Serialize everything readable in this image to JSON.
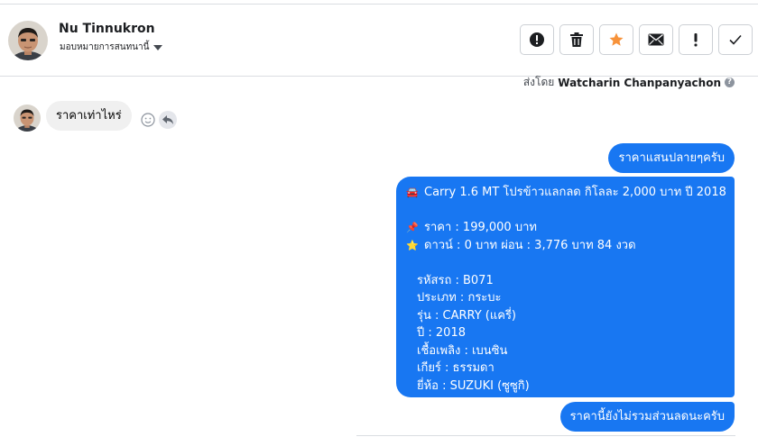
{
  "conversation": {
    "contact_name": "Nu Tinnukron",
    "assign_label": "มอบหมายการสนทนานี้",
    "sent_by_prefix": "ส่งโดย",
    "sent_by_name": "Watcharin Chanpanyachon"
  },
  "toolbar": {
    "buttons": [
      {
        "name": "spam-button",
        "icon": "alert-circle-icon"
      },
      {
        "name": "delete-button",
        "icon": "trash-icon"
      },
      {
        "name": "star-button",
        "icon": "star-icon"
      },
      {
        "name": "unread-button",
        "icon": "envelope-icon"
      },
      {
        "name": "important-button",
        "icon": "exclamation-icon"
      },
      {
        "name": "done-button",
        "icon": "check-icon"
      }
    ],
    "star_color": "#f7923a"
  },
  "messages": {
    "incoming_1": "ราคาเท่าไหร่",
    "outgoing_1": "ราคาแสนปลายๆครับ",
    "outgoing_2": {
      "title": "Carry 1.6 MT โปรข้าวแลกลด กิโลละ 2,000 บาท ปี 2018",
      "price": "ราคา : 199,000 บาท",
      "down": "ดาวน์ : 0 บาท ผ่อน : 3,776 บาท 84 งวด",
      "code": "รหัสรถ : B071",
      "type": "ประเภท : กระบะ",
      "model": "รุ่น : CARRY (แครี่)",
      "year": "ปี : 2018",
      "fuel": "เชื้อเพลิง : เบนซิน",
      "gear": "เกียร์ : ธรรมดา",
      "brand": "ยี่ห้อ : SUZUKI (ซูซูกิ)"
    },
    "outgoing_3": "ราคานี้ยังไม่รวมส่วนลดนะครับ"
  },
  "colors": {
    "outgoing_bubble": "#1877f2",
    "incoming_bubble": "#f0f0f0"
  }
}
